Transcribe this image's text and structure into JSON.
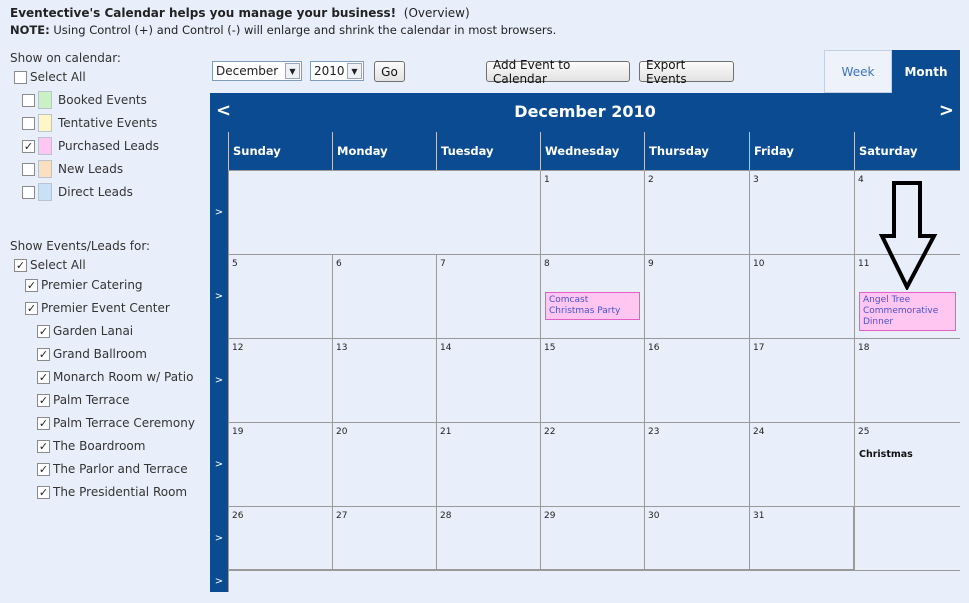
{
  "header": {
    "title": "Eventective's Calendar helps you manage your business!",
    "overview_link": "(Overview)",
    "note_label": "NOTE:",
    "note_text": "Using Control (+) and Control (-) will enlarge and shrink the calendar in most browsers."
  },
  "show_on_calendar": {
    "heading": "Show on calendar:",
    "select_all": "Select All",
    "select_all_checked": false,
    "items": [
      {
        "label": "Booked Events",
        "checked": false,
        "color": "#c9f1c3"
      },
      {
        "label": "Tentative Events",
        "checked": false,
        "color": "#fff6c8"
      },
      {
        "label": "Purchased Leads",
        "checked": true,
        "color": "#ffc6f2"
      },
      {
        "label": "New Leads",
        "checked": false,
        "color": "#fbe0c0"
      },
      {
        "label": "Direct Leads",
        "checked": false,
        "color": "#c8e1f6"
      }
    ]
  },
  "show_for": {
    "heading": "Show Events/Leads for:",
    "select_all": "Select All",
    "venues": [
      {
        "label": "Premier Catering",
        "checked": true,
        "level": 1
      },
      {
        "label": "Premier Event Center",
        "checked": true,
        "level": 1
      },
      {
        "label": "Garden Lanai",
        "checked": true,
        "level": 2
      },
      {
        "label": "Grand Ballroom",
        "checked": true,
        "level": 2
      },
      {
        "label": "Monarch Room w/ Patio",
        "checked": true,
        "level": 2
      },
      {
        "label": "Palm Terrace",
        "checked": true,
        "level": 2
      },
      {
        "label": "Palm Terrace Ceremony",
        "checked": true,
        "level": 2
      },
      {
        "label": "The Boardroom",
        "checked": true,
        "level": 2
      },
      {
        "label": "The Parlor and Terrace",
        "checked": true,
        "level": 2
      },
      {
        "label": "The Presidential Room",
        "checked": true,
        "level": 2
      }
    ]
  },
  "controls": {
    "month_value": "December",
    "year_value": "2010",
    "go_label": "Go",
    "add_event_label": "Add Event to Calendar",
    "export_label": "Export Events"
  },
  "view_tabs": {
    "week_label": "Week",
    "month_label": "Month",
    "active": "Month"
  },
  "calendar": {
    "title": "December 2010",
    "prev_label": "<",
    "next_label": ">",
    "week_expand_label": ">",
    "days_of_week": [
      "Sunday",
      "Monday",
      "Tuesday",
      "Wednesday",
      "Thursday",
      "Friday",
      "Saturday"
    ],
    "weeks": [
      [
        null,
        null,
        null,
        {
          "day": "1"
        },
        {
          "day": "2"
        },
        {
          "day": "3"
        },
        {
          "day": "4"
        }
      ],
      [
        {
          "day": "5"
        },
        {
          "day": "6"
        },
        {
          "day": "7"
        },
        {
          "day": "8",
          "event": "Comcast Christmas Party"
        },
        {
          "day": "9"
        },
        {
          "day": "10"
        },
        {
          "day": "11",
          "event": "Angel Tree Commemorative Dinner"
        }
      ],
      [
        {
          "day": "12"
        },
        {
          "day": "13"
        },
        {
          "day": "14"
        },
        {
          "day": "15"
        },
        {
          "day": "16"
        },
        {
          "day": "17"
        },
        {
          "day": "18"
        }
      ],
      [
        {
          "day": "19"
        },
        {
          "day": "20"
        },
        {
          "day": "21"
        },
        {
          "day": "22"
        },
        {
          "day": "23"
        },
        {
          "day": "24"
        },
        {
          "day": "25",
          "holiday": "Christmas"
        }
      ],
      [
        {
          "day": "26"
        },
        {
          "day": "27"
        },
        {
          "day": "28"
        },
        {
          "day": "29"
        },
        {
          "day": "30"
        },
        {
          "day": "31"
        },
        null
      ],
      [
        null,
        null,
        null,
        null,
        null,
        null,
        null
      ]
    ],
    "colors": {
      "header_bg": "#0a4b92",
      "event_bg": "#ffc6f2",
      "event_border": "#e460c6",
      "event_text": "#4d52c9"
    }
  }
}
